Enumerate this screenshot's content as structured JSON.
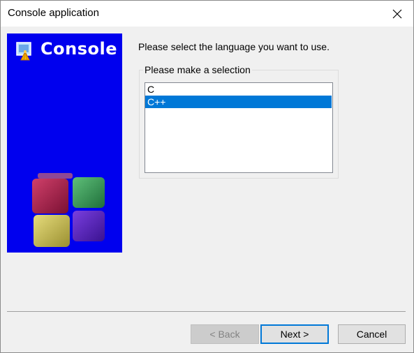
{
  "window": {
    "title": "Console application"
  },
  "banner": {
    "title": "Console"
  },
  "wizard": {
    "prompt": "Please select the language you want to use.",
    "group_label": "Please make a selection",
    "options": [
      {
        "label": "C",
        "selected": false
      },
      {
        "label": "C++",
        "selected": true
      }
    ]
  },
  "buttons": {
    "back": "< Back",
    "next": "Next >",
    "cancel": "Cancel"
  },
  "icons": {
    "close": "close-icon",
    "logo": "wizard-logo-icon"
  },
  "colors": {
    "banner": "#0000ee",
    "selection": "#0078d7",
    "default_button_border": "#0078d7"
  }
}
